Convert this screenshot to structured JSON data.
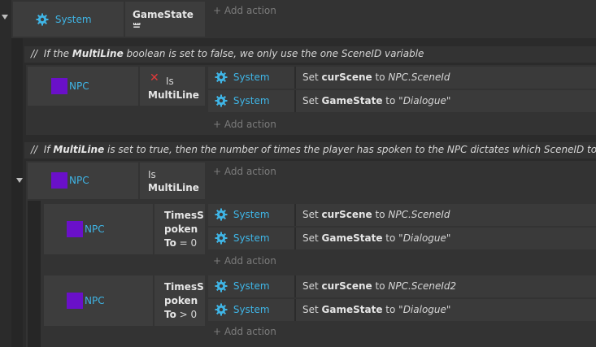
{
  "event1": {
    "object": "System",
    "condition_line1": "GameState =",
    "condition_line2": "\"\"",
    "add_action": "Add action"
  },
  "comment1": {
    "prefix": "//",
    "text_a": "If the ",
    "bold": "MultiLine",
    "text_b": " boolean is set to false, we only use the one SceneID variable"
  },
  "event2": {
    "object": "NPC",
    "cond_not": "✕",
    "cond_is": "Is",
    "cond_bold": "MultiLine",
    "actions": [
      {
        "object": "System",
        "pre": "Set ",
        "var": "curScene",
        "mid": " to ",
        "val": "NPC.SceneId"
      },
      {
        "object": "System",
        "pre": "Set ",
        "var": "GameState",
        "mid": " to ",
        "val": "\"Dialogue\""
      }
    ],
    "add_action": "Add action"
  },
  "comment2": {
    "prefix": "//",
    "text_a": "If ",
    "bold": "MultiLine",
    "text_b": " is set to true, then the number of times the player has spoken to the NPC dictates which SceneID to use."
  },
  "event3": {
    "object": "NPC",
    "cond_is": "Is",
    "cond_bold": "MultiLine",
    "add_action": "Add action"
  },
  "sub1": {
    "object": "NPC",
    "cond_l1": "TimesS",
    "cond_l2": "poken",
    "cond_l3a": "To",
    "cond_l3b": " = 0",
    "actions": [
      {
        "object": "System",
        "pre": "Set ",
        "var": "curScene",
        "mid": " to ",
        "val": "NPC.SceneId"
      },
      {
        "object": "System",
        "pre": "Set ",
        "var": "GameState",
        "mid": " to ",
        "val": "\"Dialogue\""
      }
    ],
    "add_action": "Add action"
  },
  "sub2": {
    "object": "NPC",
    "cond_l1": "TimesS",
    "cond_l2": "poken",
    "cond_l3a": "To",
    "cond_l3b": " > 0",
    "actions": [
      {
        "object": "System",
        "pre": "Set ",
        "var": "curScene",
        "mid": " to ",
        "val": "NPC.SceneId2"
      },
      {
        "object": "System",
        "pre": "Set ",
        "var": "GameState",
        "mid": " to ",
        "val": "\"Dialogue\""
      }
    ],
    "add_action": "Add action"
  },
  "colors": {
    "accent": "#3fb5e6",
    "npc_swatch": "#6a10c9",
    "invert": "#e03a3a"
  },
  "icons": {
    "system": "gear-icon",
    "invert": "close-icon",
    "add": "plus-icon",
    "collapse": "chevron-down-icon"
  }
}
